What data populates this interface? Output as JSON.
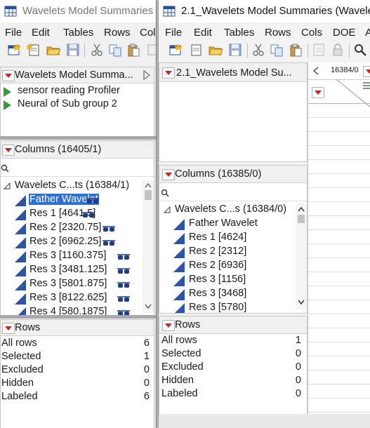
{
  "win1": {
    "title": "Wavelets Model Summaries (",
    "menu": [
      "File",
      "Edit",
      "Tables",
      "Rows",
      "Cols"
    ],
    "table_panel": {
      "title": "Wavelets Model Summa..."
    },
    "scripts": [
      "sensor reading Profiler",
      "Neural of Sub group 2"
    ],
    "columns_header": "Columns (16405/1)",
    "group_label": "Wavelets C...ts (16384/1)",
    "columns": [
      "Father Wavelet",
      "Res 1 [4641.5]",
      "Res 2 [2320.75]",
      "Res 2 [6962.25]",
      "Res 3 [1160.375]",
      "Res 3 [3481.125]",
      "Res 3 [5801.875]",
      "Res 3 [8122.625]",
      "Res 4 [580.1875]"
    ],
    "rows_header": "Rows",
    "rows": [
      {
        "label": "All rows",
        "value": "6"
      },
      {
        "label": "Selected",
        "value": "1"
      },
      {
        "label": "Excluded",
        "value": "0"
      },
      {
        "label": "Hidden",
        "value": "0"
      },
      {
        "label": "Labeled",
        "value": "6"
      }
    ]
  },
  "win2": {
    "title": "2.1_Wavelets Model Summaries (Wavele",
    "menu": [
      "File",
      "Edit",
      "Tables",
      "Rows",
      "Cols",
      "DOE",
      "A"
    ],
    "table_panel": {
      "title": "2.1_Wavelets Model Su..."
    },
    "columns_header": "Columns (16385/0)",
    "group_label": "Wavelets C...s (16384/0)",
    "columns": [
      "Father Wavelet",
      "Res 1 [4624]",
      "Res 2 [2312]",
      "Res 2 [6936]",
      "Res 3 [1156]",
      "Res 3 [3468]",
      "Res 3 [5780]"
    ],
    "grid_header": "16384/0",
    "rows_header": "Rows",
    "rows": [
      {
        "label": "All rows",
        "value": "1"
      },
      {
        "label": "Selected",
        "value": "0"
      },
      {
        "label": "Excluded",
        "value": "0"
      },
      {
        "label": "Hidden",
        "value": "0"
      },
      {
        "label": "Labeled",
        "value": "0"
      }
    ]
  },
  "colors": {
    "selection": "#2f6fd6",
    "column_icon": "#2c54a8",
    "script_icon": "#3b9a3b",
    "disclosure": "#d21f1f",
    "grid_line": "#cfe0f2"
  }
}
